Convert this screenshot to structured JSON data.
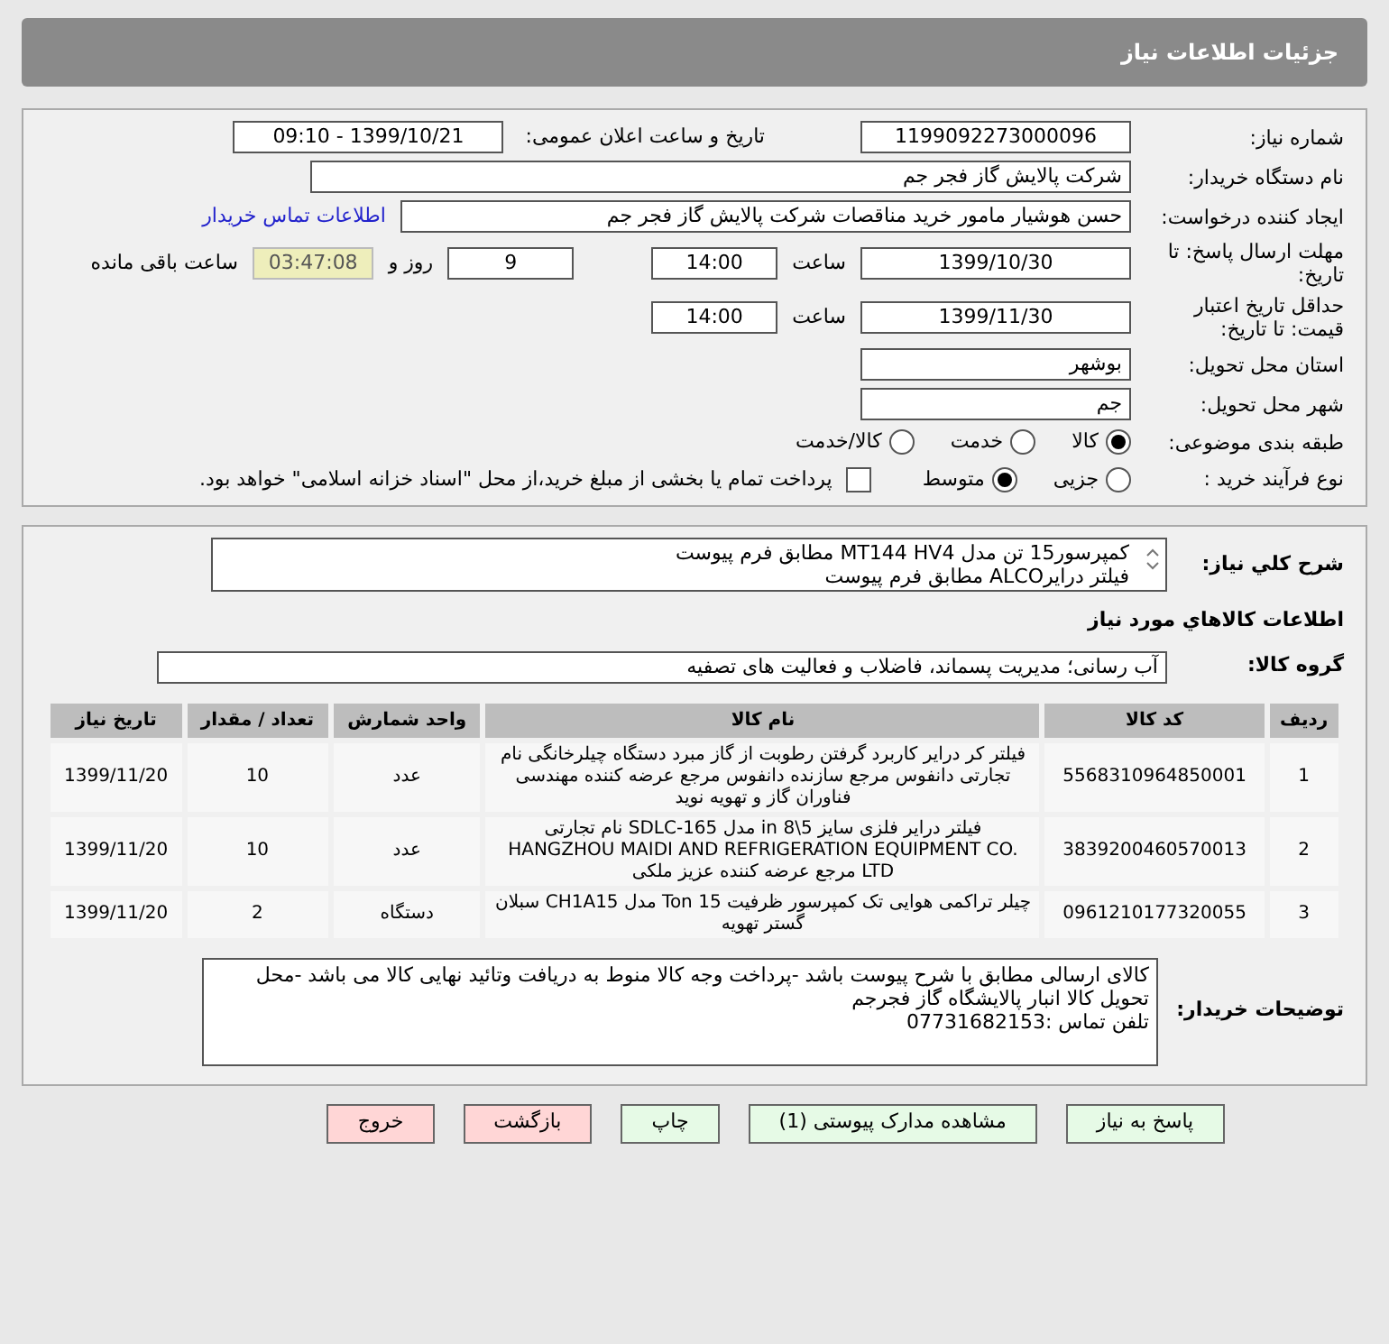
{
  "header": {
    "title": "جزئیات اطلاعات نیاز"
  },
  "need_number": {
    "label": "شماره نیاز:",
    "value": "1199092273000096"
  },
  "announce": {
    "label": "تاریخ و ساعت اعلان عمومی:",
    "value": "1399/10/21 - 09:10"
  },
  "buyer": {
    "label": "نام دستگاه خریدار:",
    "value": "شرکت پالایش گاز فجر جم"
  },
  "creator": {
    "label": "ایجاد کننده درخواست:",
    "value": "حسن هوشیار مامور خرید مناقصات شرکت پالایش گاز فجر جم",
    "link": "اطلاعات تماس خریدار"
  },
  "deadline": {
    "label": "مهلت ارسال پاسخ: تا تاریخ:",
    "date": "1399/10/30",
    "time_label": "ساعت",
    "time": "14:00",
    "days": "9",
    "days_label": "روز و",
    "remaining": "03:47:08",
    "remaining_label": "ساعت باقی مانده"
  },
  "validity": {
    "label": "حداقل تاریخ اعتبار قیمت: تا تاریخ:",
    "date": "1399/11/30",
    "time_label": "ساعت",
    "time": "14:00"
  },
  "province": {
    "label": "استان محل تحویل:",
    "value": "بوشهر"
  },
  "city": {
    "label": "شهر محل تحویل:",
    "value": "جم"
  },
  "category": {
    "label": "طبقه بندی موضوعی:",
    "options": [
      {
        "label": "کالا",
        "selected": true
      },
      {
        "label": "خدمت",
        "selected": false
      },
      {
        "label": "کالا/خدمت",
        "selected": false
      }
    ]
  },
  "purchase_type": {
    "label": "نوع فرآیند خرید :",
    "options": [
      {
        "label": "جزیی",
        "selected": false
      },
      {
        "label": "متوسط",
        "selected": true
      }
    ],
    "payment": {
      "checked": false,
      "label": "پرداخت تمام یا بخشی از مبلغ خرید،از محل \"اسناد خزانه اسلامی\" خواهد بود."
    }
  },
  "summary": {
    "label": "شرح کلي نياز:",
    "lines": [
      "کمپرسور15 تن مدل MT144 HV4 مطابق فرم پیوست",
      "فیلتر درایرALCO مطابق فرم پیوست"
    ]
  },
  "goods_title": "اطلاعات کالاهاي مورد نياز",
  "goods_group": {
    "label": "گروه کالا:",
    "value": "آب رسانی؛ مدیریت پسماند، فاضلاب و فعالیت های تصفیه"
  },
  "table": {
    "columns": [
      "ردیف",
      "کد کالا",
      "نام کالا",
      "واحد شمارش",
      "تعداد / مقدار",
      "تاریخ نیاز"
    ],
    "rows": [
      [
        "1",
        "5568310964850001",
        "فیلتر کر درایر کاربرد گرفتن رطوبت از گاز مبرد دستگاه چیلرخانگی نام تجارتی دانفوس مرجع سازنده دانفوس مرجع عرضه کننده مهندسی فناوران گاز و تهویه نوید",
        "عدد",
        "10",
        "1399/11/20"
      ],
      [
        "2",
        "3839200460570013",
        "فیلتر درایر فلزی سایز 5\\8 in مدل SDLC-165 نام تجارتی HANGZHOU MAIDI AND REFRIGERATION EQUIPMENT CO. LTD مرجع عرضه کننده عزیز ملکی",
        "عدد",
        "10",
        "1399/11/20"
      ],
      [
        "3",
        "0961210177320055",
        "چیلر تراکمی هوایی تک کمپرسور ظرفیت 15 Ton مدل CH1A15 سبلان گستر تهویه",
        "دستگاه",
        "2",
        "1399/11/20"
      ]
    ]
  },
  "notes": {
    "label": "توضیحات خریدار:",
    "lines": [
      "کالای ارسالی مطابق با شرح پیوست باشد -پرداخت وجه کالا  منوط به دریافت وتائید نهایی کالا می باشد -محل تحویل کالا انبار پالایشگاه گاز فجرجم",
      "تلفن تماس :07731682153"
    ]
  },
  "buttons": [
    {
      "label": "پاسخ به نیاز",
      "kind": "green"
    },
    {
      "label": "مشاهده مدارک پیوستی (1)",
      "kind": "green"
    },
    {
      "label": "چاپ",
      "kind": "green"
    },
    {
      "label": "بازگشت",
      "kind": "red"
    },
    {
      "label": "خروج",
      "kind": "red"
    }
  ]
}
